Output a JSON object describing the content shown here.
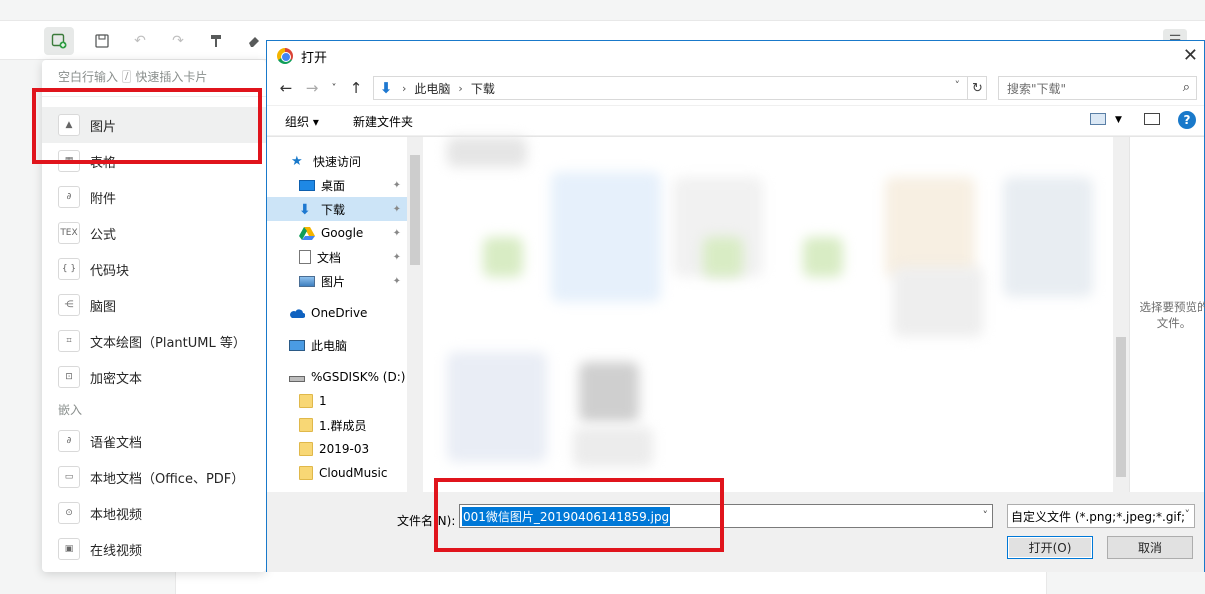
{
  "editor": {
    "insert_menu": {
      "search_placeholder": "空白行输入",
      "slash_key": "/",
      "search_hint": "快速插入卡片",
      "items": [
        {
          "label": "图片",
          "icon": "image-icon",
          "glyph": "▲"
        },
        {
          "label": "表格",
          "icon": "table-icon",
          "glyph": "▦"
        },
        {
          "label": "附件",
          "icon": "paperclip-icon",
          "glyph": "∂"
        },
        {
          "label": "公式",
          "icon": "tex-icon",
          "glyph": "TEX"
        },
        {
          "label": "代码块",
          "icon": "code-block-icon",
          "glyph": "{ }"
        },
        {
          "label": "脑图",
          "icon": "mindmap-icon",
          "glyph": "⋲"
        },
        {
          "label": "文本绘图（PlantUML 等）",
          "icon": "diagram-icon",
          "glyph": "⌗"
        },
        {
          "label": "加密文本",
          "icon": "lock-icon",
          "glyph": "⊡"
        }
      ],
      "section_embed": "嵌入",
      "embed_items": [
        {
          "label": "语雀文档",
          "icon": "yuque-doc-icon",
          "glyph": "∂"
        },
        {
          "label": "本地文档（Office、PDF）",
          "icon": "folder-open-icon",
          "glyph": "▭"
        },
        {
          "label": "本地视频",
          "icon": "video-icon",
          "glyph": "⊙"
        },
        {
          "label": "在线视频",
          "icon": "online-video-icon",
          "glyph": "▣"
        }
      ]
    }
  },
  "dialog": {
    "title": "打开",
    "close_label": "✕",
    "breadcrumbs": [
      "此电脑",
      "下载"
    ],
    "search_placeholder": "搜索\"下载\"",
    "organize_label": "组织 ▾",
    "new_folder_label": "新建文件夹",
    "help_label": "?",
    "nav_items": [
      {
        "label": "快速访问",
        "icon": "star-icon",
        "pinned": false
      },
      {
        "label": "桌面",
        "icon": "desktop-icon",
        "pinned": true
      },
      {
        "label": "下载",
        "icon": "download-icon",
        "pinned": true
      },
      {
        "label": "Google",
        "icon": "google-drive-icon",
        "pinned": true
      },
      {
        "label": "文档",
        "icon": "document-icon",
        "pinned": true
      },
      {
        "label": "图片",
        "icon": "pictures-icon",
        "pinned": true
      },
      {
        "label": "OneDrive",
        "icon": "onedrive-icon",
        "pinned": false
      },
      {
        "label": "此电脑",
        "icon": "computer-icon",
        "pinned": false
      },
      {
        "label": "%GSDISK% (D:)",
        "icon": "drive-icon",
        "pinned": false
      },
      {
        "label": "1",
        "icon": "folder-icon",
        "pinned": false
      },
      {
        "label": "1.群成员",
        "icon": "folder-icon",
        "pinned": false
      },
      {
        "label": "2019-03",
        "icon": "folder-icon",
        "pinned": false
      },
      {
        "label": "CloudMusic",
        "icon": "folder-icon",
        "pinned": false
      }
    ],
    "preview_text": "选择要预览的文件。",
    "filename_label": "文件名(N):",
    "filename_value": "001微信图片_20190406141859.jpg",
    "filter_value": "自定义文件 (*.png;*.jpeg;*.gif;",
    "open_label": "打开(O)",
    "cancel_label": "取消"
  },
  "colors": {
    "accent": "#1979ca",
    "highlight": "#e0141c",
    "selected": "#0078d7"
  }
}
